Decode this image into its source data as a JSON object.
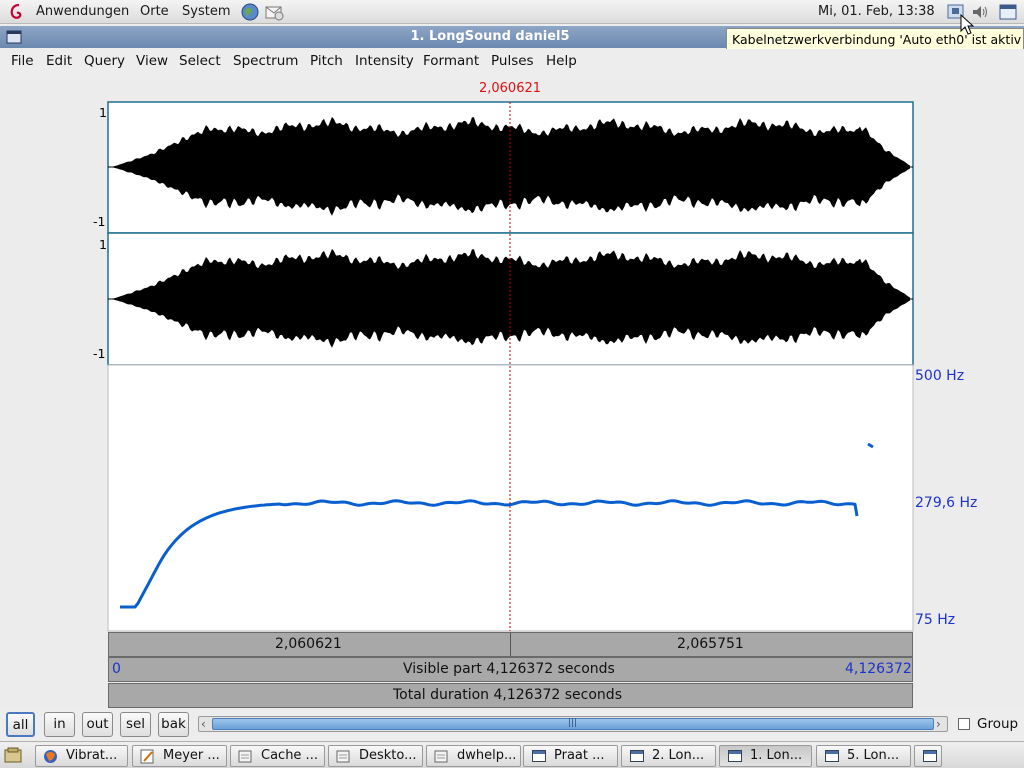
{
  "top_panel": {
    "menus": [
      "Anwendungen",
      "Orte",
      "System"
    ],
    "clock": "Mi, 01. Feb, 13:38"
  },
  "window": {
    "title": "1. LongSound daniel5",
    "tooltip": "Kabelnetzwerkverbindung 'Auto eth0' ist aktiv"
  },
  "menu_bar": [
    "File",
    "Edit",
    "Query",
    "View",
    "Select",
    "Spectrum",
    "Pitch",
    "Intensity",
    "Formant",
    "Pulses",
    "Help"
  ],
  "editor": {
    "cursor_time": "2,060621",
    "channel1": {
      "top_label": "1",
      "bottom_label": "-1"
    },
    "channel2": {
      "top_label": "1",
      "bottom_label": "-1"
    },
    "pitch_axis": {
      "top": "500 Hz",
      "mid": "279,6 Hz",
      "bottom": "75 Hz"
    },
    "time_bar": {
      "left": "2,060621",
      "right": "2,065751"
    },
    "visible_bar": {
      "start": "0",
      "text": "Visible part 4,126372 seconds",
      "end": "4,126372"
    },
    "total_bar": {
      "text": "Total duration 4,126372 seconds"
    },
    "colors": {
      "pitch": "#0a5fd0",
      "cursor": "#cc0000",
      "hz_labels": "#1a33cc",
      "waveform": "#000000"
    }
  },
  "buttons": {
    "all": "all",
    "in": "in",
    "out": "out",
    "sel": "sel",
    "bak": "bak"
  },
  "group_label": "Group",
  "taskbar": [
    {
      "label": "Vibrat...",
      "icon": "firefox-icon"
    },
    {
      "label": "Meyer ...",
      "icon": "text-editor-icon"
    },
    {
      "label": "Cache ...",
      "icon": "file-manager-icon"
    },
    {
      "label": "Deskto...",
      "icon": "file-manager-icon"
    },
    {
      "label": "dwhelp...",
      "icon": "file-manager-icon"
    },
    {
      "label": "Praat ...",
      "icon": "window-icon"
    },
    {
      "label": "2. Lon...",
      "icon": "window-icon"
    },
    {
      "label": "1. Lon...",
      "icon": "window-icon"
    },
    {
      "label": "5. Lon...",
      "icon": "window-icon"
    }
  ]
}
